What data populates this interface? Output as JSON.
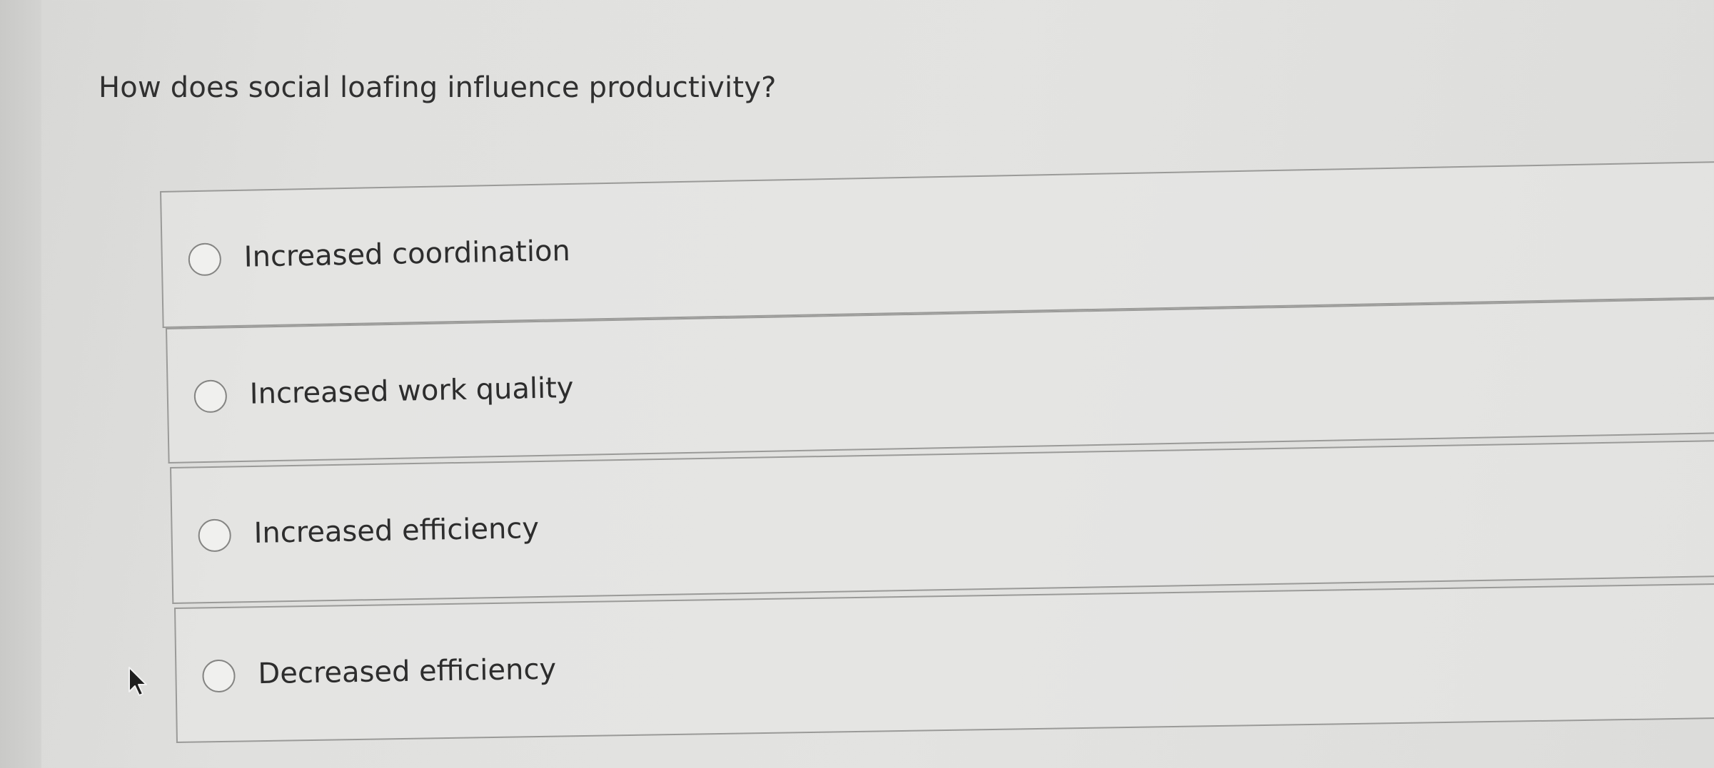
{
  "question": {
    "text": "How does social loafing influence productivity?"
  },
  "options": [
    {
      "label": "Increased coordination",
      "selected": false
    },
    {
      "label": "Increased work quality",
      "selected": false
    },
    {
      "label": "Increased efficiency",
      "selected": false
    },
    {
      "label": "Decreased efficiency",
      "selected": false
    }
  ],
  "icons": {
    "radio": "radio-button-icon",
    "cursor": "mouse-pointer-icon"
  },
  "colors": {
    "background": "#e1e1df",
    "border": "#9a9a98",
    "text": "#2d2d2d"
  }
}
